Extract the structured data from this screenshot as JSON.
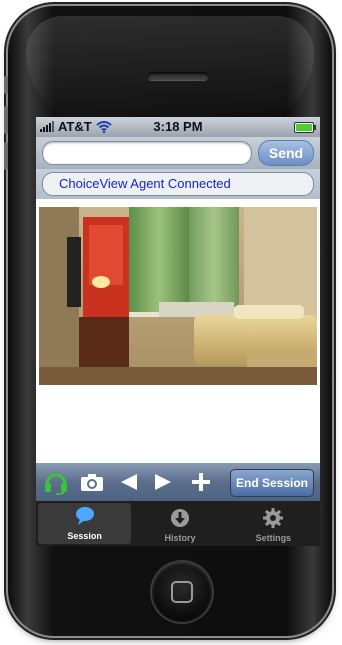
{
  "status_bar": {
    "carrier": "AT&T",
    "time": "3:18 PM"
  },
  "address_bar": {
    "value": "",
    "placeholder": "",
    "send_label": "Send"
  },
  "session_status": "ChoiceView Agent Connected",
  "toolbar": {
    "icons": [
      "headset-icon",
      "camera-icon",
      "back-arrow-icon",
      "forward-arrow-icon",
      "plus-icon"
    ],
    "end_session_label": "End Session"
  },
  "tabs": [
    {
      "label": "Session",
      "icon": "speech-bubble-icon",
      "active": true
    },
    {
      "label": "History",
      "icon": "download-icon",
      "active": false
    },
    {
      "label": "Settings",
      "icon": "gear-icon",
      "active": false
    }
  ],
  "colors": {
    "accent_blue": "#6b8fc5",
    "status_text": "#1a22c8",
    "headset_green": "#3bc43b",
    "battery_green": "#4bd12b"
  }
}
